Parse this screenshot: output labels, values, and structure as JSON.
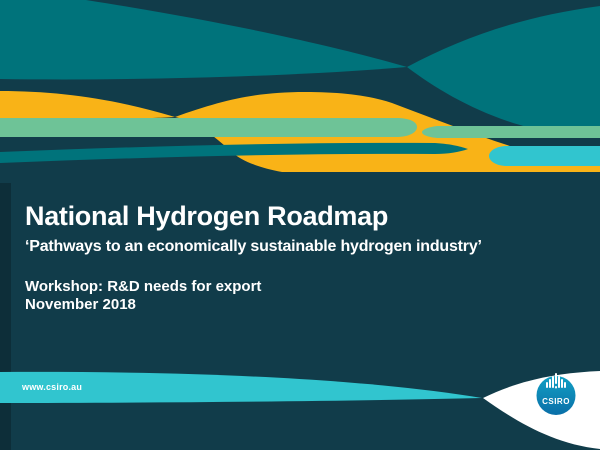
{
  "colors": {
    "background_dark": "#113C4A",
    "teal": "#00737B",
    "orange": "#F9B317",
    "mint": "#6EC397",
    "cyan": "#31C5CF",
    "logo_blue_top": "#12A0C4",
    "logo_blue_bottom": "#0A6FA8",
    "text_white": "#FFFFFF"
  },
  "slide": {
    "title": "National Hydrogen Roadmap",
    "subtitle": "‘Pathways to an economically sustainable hydrogen industry’",
    "workshop_line": "Workshop: R&D needs for export",
    "date_line": "November 2018"
  },
  "footer": {
    "url": "www.csiro.au",
    "logo_text": "CSIRO"
  }
}
